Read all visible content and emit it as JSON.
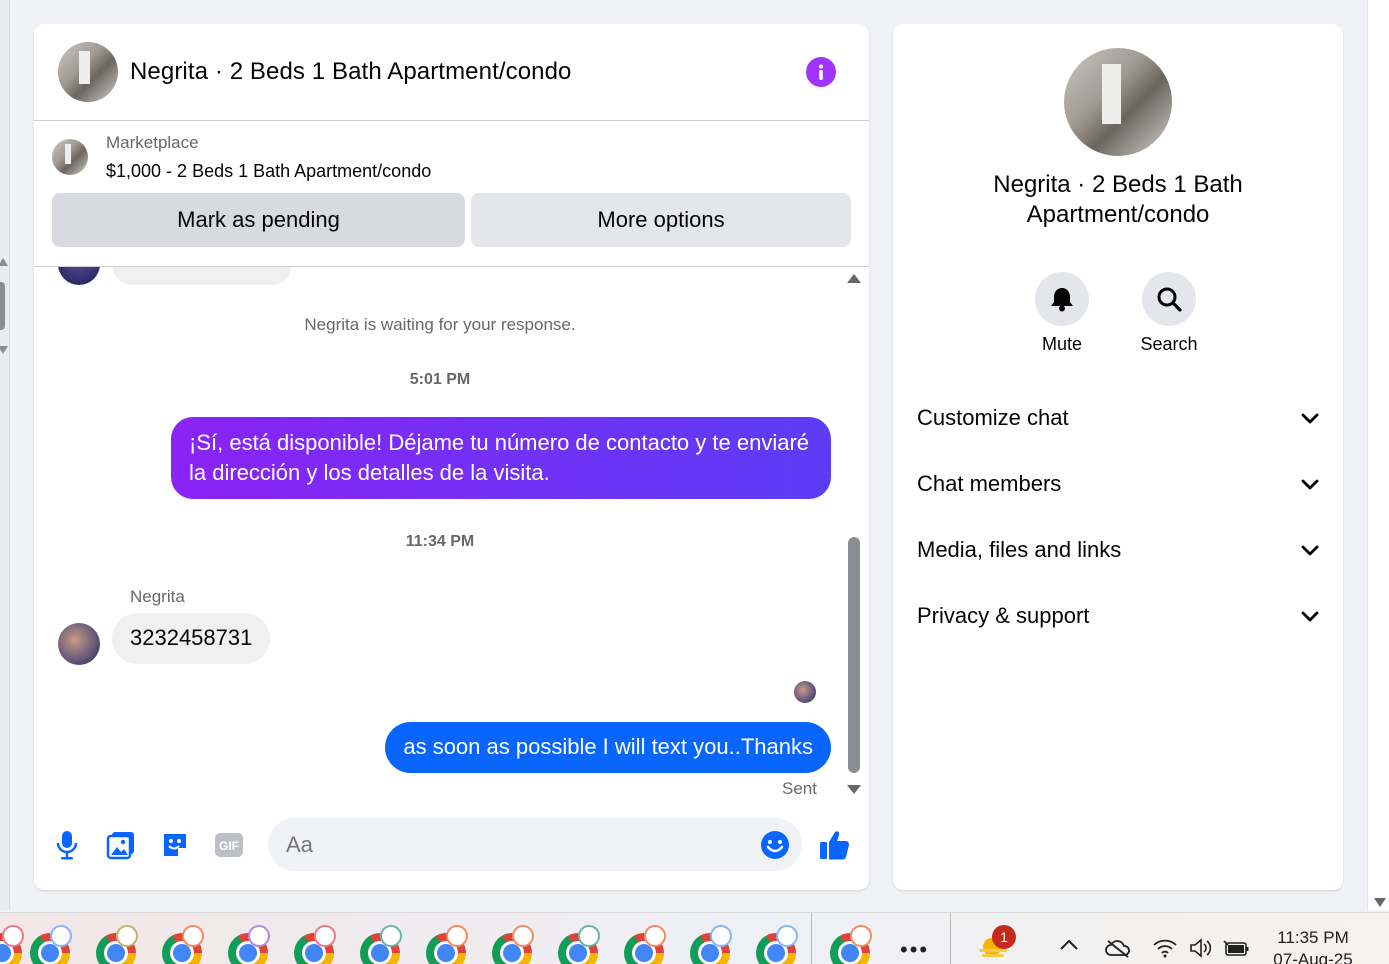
{
  "chat": {
    "title": "Negrita · 2 Beds 1 Bath Apartment/condo",
    "listing": {
      "label": "Marketplace",
      "title": "$1,000 - 2 Beds 1 Bath Apartment/condo",
      "pending_button": "Mark as pending",
      "more_button": "More options"
    },
    "messages": {
      "waiting_notice": "Negrita is waiting for your response.",
      "time_1": "5:01 PM",
      "outgoing_1": "¡Sí, está disponible! Déjame tu número de contacto y te enviaré la dirección y los detalles de la visita.",
      "time_2": "11:34 PM",
      "sender": "Negrita",
      "incoming_1": "3232458731",
      "outgoing_2": "as soon as possible I will text you..Thanks",
      "status": "Sent"
    },
    "composer": {
      "placeholder": "Aa"
    }
  },
  "details": {
    "name": "Negrita · 2 Beds 1 Bath Apartment/condo",
    "actions": [
      "Mute",
      "Search"
    ],
    "sections": [
      "Customize chat",
      "Chat members",
      "Media, files and links",
      "Privacy & support"
    ]
  },
  "taskbar": {
    "notification_count": "1",
    "time": "11:35 PM",
    "date": "07-Aug-25"
  },
  "colors": {
    "accent_purple": "#a033ff",
    "bubble_purple_start": "#8b23f6",
    "bubble_purple_end": "#5c3df5",
    "bubble_blue": "#0866ff",
    "icon_blue": "#0866ff"
  }
}
